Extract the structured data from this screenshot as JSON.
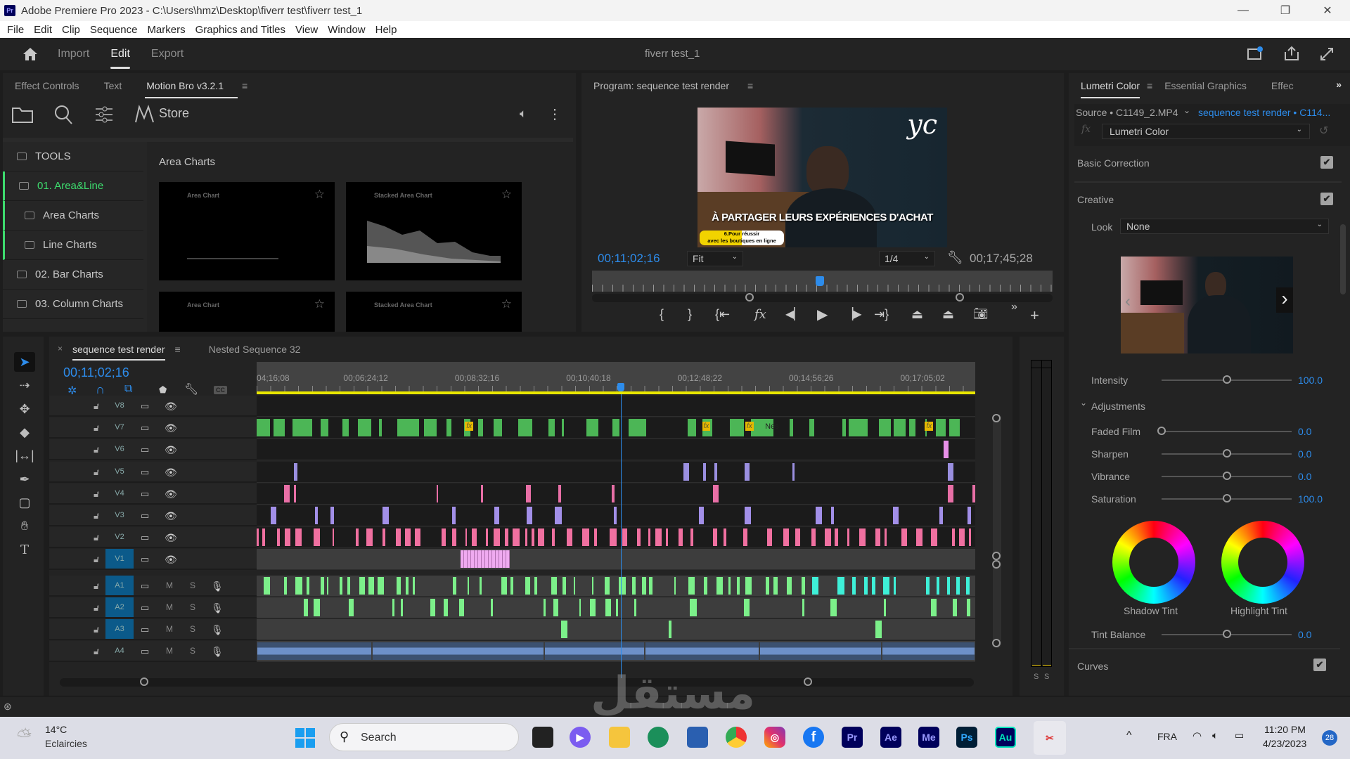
{
  "window": {
    "title": "Adobe Premiere Pro 2023 - C:\\Users\\hmz\\Desktop\\fiverr test\\fiverr test_1",
    "app_icon": "Pr",
    "controls": {
      "minimize": "—",
      "maximize": "❐",
      "close": "✕"
    }
  },
  "menu": [
    "File",
    "Edit",
    "Clip",
    "Sequence",
    "Markers",
    "Graphics and Titles",
    "View",
    "Window",
    "Help"
  ],
  "appbar": {
    "home_icon": "home-icon",
    "nav": [
      "Import",
      "Edit",
      "Export"
    ],
    "active": "Edit",
    "project_title": "fiverr test_1"
  },
  "left_panel": {
    "tabs": [
      "Effect Controls",
      "Text",
      "Motion Bro v3.2.1"
    ],
    "active_tab": "Motion Bro v3.2.1",
    "toolbar": {
      "store_label": "Store"
    },
    "categories": [
      {
        "label": "TOOLS",
        "active": false,
        "sub": false
      },
      {
        "label": "01. Area&Line",
        "active": true,
        "sub": false
      },
      {
        "label": "Area Charts",
        "active": false,
        "sub": true
      },
      {
        "label": "Line Charts",
        "active": false,
        "sub": true
      },
      {
        "label": "02. Bar Charts",
        "active": false,
        "sub": false
      },
      {
        "label": "03. Column Charts",
        "active": false,
        "sub": false
      }
    ],
    "section_title": "Area Charts",
    "presets": [
      "Area Chart",
      "Stacked Area Chart",
      "Area Chart",
      "Stacked Area Chart"
    ],
    "accent": "#3ddc6e"
  },
  "program_monitor": {
    "title": "Program: sequence test render",
    "caption": "À PARTAGER LEURS EXPÉRIENCES D'ACHAT",
    "lower_third_line1": "6.Pour réussir",
    "lower_third_line2": "avec les boutiques en ligne",
    "watermark": "yc",
    "current_timecode": "00;11;02;16",
    "zoom": "Fit",
    "resolution": "1/4",
    "duration": "00;17;45;28",
    "playhead_fraction": 0.495
  },
  "lumetri": {
    "tabs": [
      "Lumetri Color",
      "Essential Graphics",
      "Effec"
    ],
    "source": "Source • C1149_2.MP4",
    "sequence_link": "sequence test render • C114...",
    "effect": "Lumetri Color",
    "sections": {
      "basic": "Basic Correction",
      "creative": "Creative",
      "curves": "Curves"
    },
    "look_label": "Look",
    "look_value": "None",
    "intensity": {
      "label": "Intensity",
      "value": "100.0",
      "fraction": 0.5
    },
    "adjustments_label": "Adjustments",
    "sliders": [
      {
        "label": "Faded Film",
        "value": "0.0",
        "fraction": 0.0
      },
      {
        "label": "Sharpen",
        "value": "0.0",
        "fraction": 0.5
      },
      {
        "label": "Vibrance",
        "value": "0.0",
        "fraction": 0.5
      },
      {
        "label": "Saturation",
        "value": "100.0",
        "fraction": 0.5
      }
    ],
    "shadow_tint": "Shadow Tint",
    "highlight_tint": "Highlight Tint",
    "tint_balance": {
      "label": "Tint Balance",
      "value": "0.0",
      "fraction": 0.5
    }
  },
  "timeline": {
    "tabs": [
      "sequence test render",
      "Nested Sequence 32"
    ],
    "active_tab": "sequence test render",
    "timecode": "00;11;02;16",
    "ruler": [
      "04;16;08",
      "00;06;24;12",
      "00;08;32;16",
      "00;10;40;18",
      "00;12;48;22",
      "00;14;56;26",
      "00;17;05;02"
    ],
    "playhead_fraction": 0.507,
    "video_tracks": [
      "V8",
      "V7",
      "V6",
      "V5",
      "V4",
      "V3",
      "V2",
      "V1"
    ],
    "audio_tracks": [
      "A1",
      "A2",
      "A3",
      "A4"
    ],
    "targeted": [
      "V1",
      "A1",
      "A2",
      "A3"
    ],
    "mute_label": "M",
    "solo_label": "S",
    "clip_label_nested": "Nes",
    "meter_labels": [
      "S",
      "S"
    ]
  },
  "taskbar": {
    "weather_temp": "14°C",
    "weather_desc": "Eclaircies",
    "search_placeholder": "Search",
    "apps": [
      "Pr",
      "Ae",
      "Me",
      "Ps",
      "Au"
    ],
    "language": "FRA",
    "time": "11:20 PM",
    "date": "4/23/2023",
    "notifications": "28"
  },
  "watermark_overlay": "مستقل"
}
